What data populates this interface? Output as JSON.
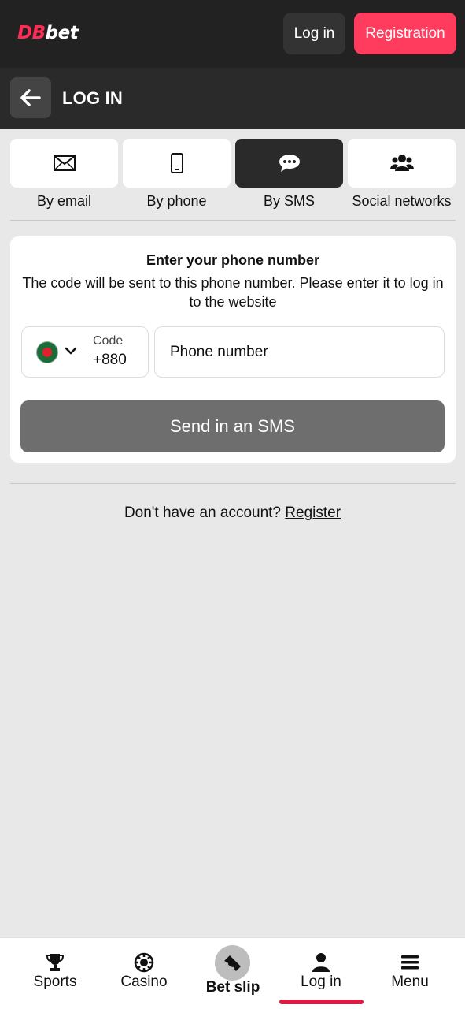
{
  "header": {
    "logo_part1": "DB",
    "logo_part2": "bet",
    "login_label": "Log in",
    "registration_label": "Registration"
  },
  "subheader": {
    "title": "LOG IN"
  },
  "tabs": [
    {
      "label": "By email",
      "icon": "envelope-icon",
      "active": false
    },
    {
      "label": "By phone",
      "icon": "smartphone-icon",
      "active": false
    },
    {
      "label": "By SMS",
      "icon": "chat-bubble-icon",
      "active": true
    },
    {
      "label": "Social networks",
      "icon": "users-group-icon",
      "active": false
    }
  ],
  "form": {
    "title": "Enter your phone number",
    "description": "The code will be sent to this phone number. Please enter it to log in to the website",
    "code_label": "Code",
    "code_value": "+880",
    "flag": "bangladesh-flag-icon",
    "phone_placeholder": "Phone number",
    "submit_label": "Send in an SMS"
  },
  "footer_prompt": {
    "text": "Don't have an account?",
    "link": "Register"
  },
  "bottom_nav": [
    {
      "label": "Sports",
      "icon": "trophy-icon"
    },
    {
      "label": "Casino",
      "icon": "casino-chip-icon"
    },
    {
      "label": "Bet slip",
      "icon": "ticket-icon"
    },
    {
      "label": "Log in",
      "icon": "user-icon",
      "active": true
    },
    {
      "label": "Menu",
      "icon": "hamburger-menu-icon"
    }
  ],
  "colors": {
    "accent": "#ff3b5e",
    "active_underline": "#d81e45",
    "header_bg": "#222222",
    "submit_disabled": "#6e6e6e"
  }
}
